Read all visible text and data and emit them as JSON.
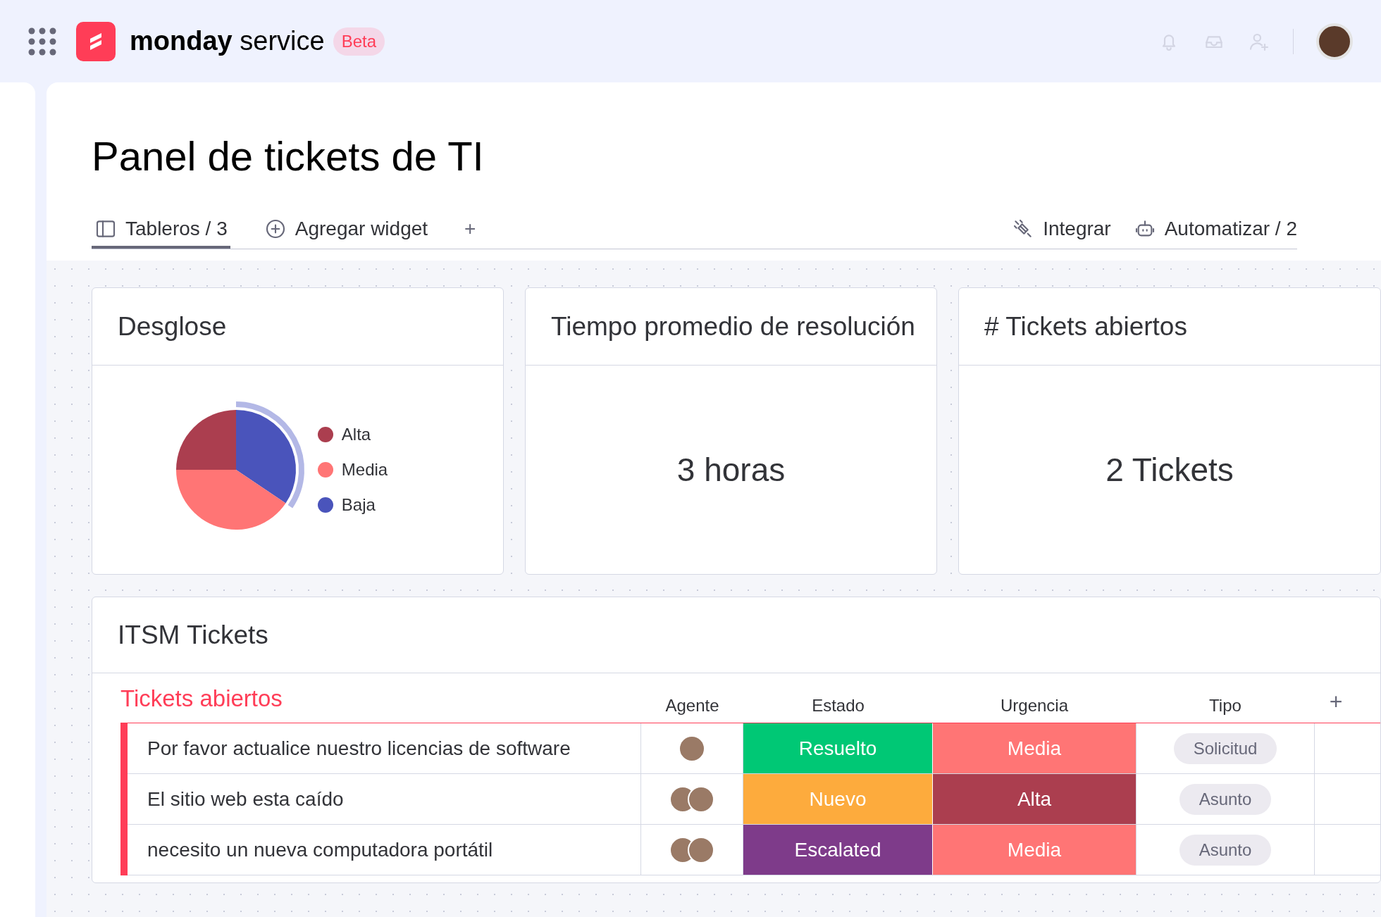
{
  "header": {
    "logo_bold": "monday",
    "logo_light": "service",
    "badge": "Beta"
  },
  "page": {
    "title": "Panel de tickets de TI"
  },
  "tabs": [
    {
      "label": "Tableros / 3",
      "selected": true
    },
    {
      "label": "Agregar widget",
      "selected": false
    },
    {
      "label": "+",
      "selected": false
    }
  ],
  "actions": [
    "Integrar",
    "Automatizar / 2"
  ],
  "widgets": [
    {
      "kind": "pie",
      "title": "Desglose",
      "legend": [
        {
          "label": "Alta",
          "color": "#ab3e4f"
        },
        {
          "label": "Media",
          "color": "#ff7575"
        },
        {
          "label": "Baja",
          "color": "#4a54bb"
        }
      ]
    },
    {
      "kind": "number",
      "title": "Tiempo promedio de resolución",
      "value": "3 horas"
    },
    {
      "kind": "number",
      "title": "# Tickets abiertos",
      "value": "2 Tickets"
    }
  ],
  "board": {
    "title": "ITSM Tickets",
    "group": "Tickets abiertos",
    "columns": [
      "Agente",
      "Estado",
      "Urgencia",
      "Tipo"
    ],
    "add_column": "+",
    "rows": [
      {
        "name": "Por favor actualice nuestro licencias de software",
        "agents": [
          {
            "kind": "photo"
          }
        ],
        "estado": {
          "label": "Resuelto",
          "color": "#00c875"
        },
        "urgencia": {
          "label": "Media",
          "color": "#ff7575"
        },
        "tipo": "Solicitud"
      },
      {
        "name": "El sitio web esta caído",
        "agents": [
          {
            "kind": "photo"
          },
          {
            "kind": "photo"
          }
        ],
        "estado": {
          "label": "Nuevo",
          "color": "#fdab3d"
        },
        "urgencia": {
          "label": "Alta",
          "color": "#ab3e4f"
        },
        "tipo": "Asunto"
      },
      {
        "name": "necesito un nueva computadora portátil",
        "agents": [
          {
            "kind": "photo"
          },
          {
            "kind": "photo"
          }
        ],
        "estado": {
          "label": "Escalated",
          "color": "#7e3b8a"
        },
        "urgencia": {
          "label": "Media",
          "color": "#ff7575"
        },
        "tipo": "Asunto"
      }
    ]
  }
}
